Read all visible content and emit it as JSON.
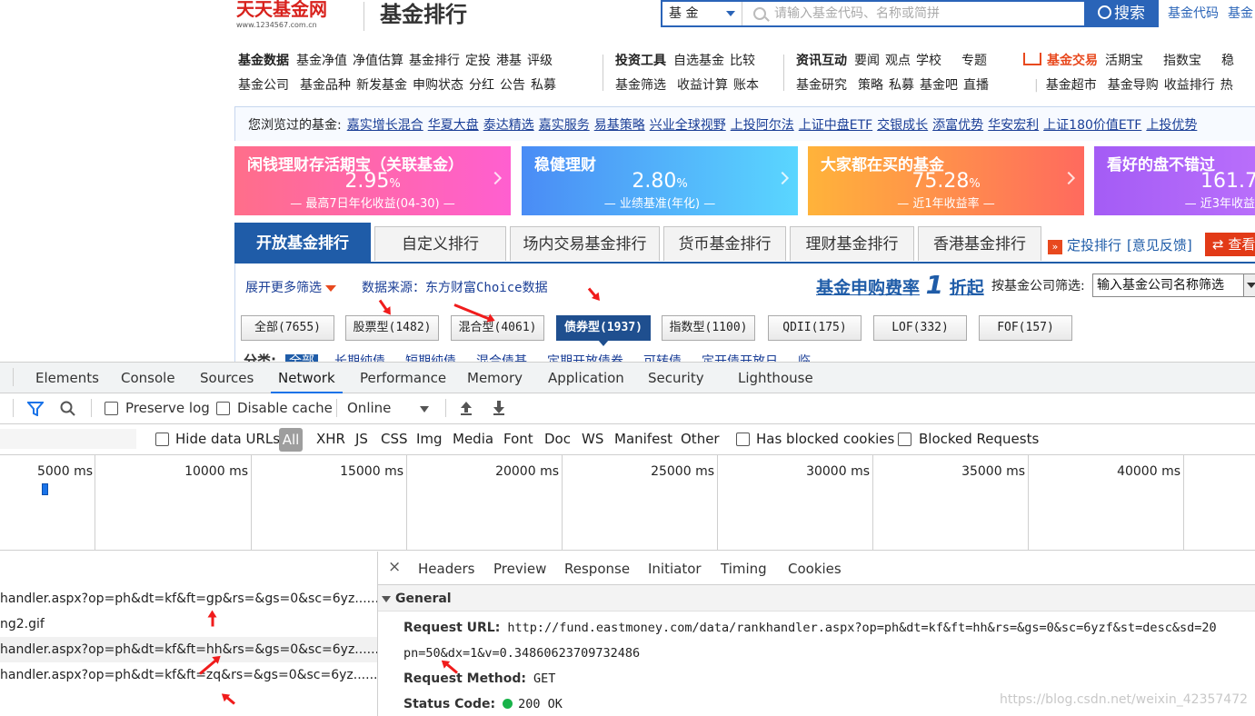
{
  "site": {
    "logo_text": "天天基金网",
    "logo_url": "www.1234567.com.cn",
    "page_title": "基金排行",
    "search": {
      "type_value": "基 金",
      "placeholder": "请输入基金代码、名称或简拼",
      "button": "搜索"
    },
    "top_links": [
      "基金代码",
      "基金"
    ],
    "nav_groups": [
      {
        "row1": {
          "title": "基金数据",
          "items": [
            "基金净值",
            "净值估算",
            "基金排行",
            "定投",
            "港基",
            "评级"
          ]
        },
        "row2": [
          "基金公司",
          "基金品种",
          "新发基金",
          "申购状态",
          "分红",
          "公告",
          "私募"
        ]
      },
      {
        "row1": {
          "title": "投资工具",
          "items": [
            "自选基金",
            "比较"
          ]
        },
        "row2": [
          "基金筛选",
          "收益计算",
          "账本"
        ]
      },
      {
        "row1": {
          "title": "资讯互动",
          "items": [
            "要闻",
            "观点",
            "学校",
            "专题"
          ]
        },
        "row2": [
          "基金研究",
          "策略",
          "私募",
          "基金吧",
          "直播"
        ]
      },
      {
        "row1": {
          "title": "基金交易",
          "items": [
            "活期宝",
            "指数宝",
            "稳"
          ]
        },
        "row2": [
          "基金超市",
          "基金导购",
          "收益排行",
          "热"
        ]
      }
    ],
    "browsed": {
      "label": "您浏览过的基金:",
      "items": [
        "嘉实增长混合",
        "华夏大盘",
        "泰达精选",
        "嘉实服务",
        "易基策略",
        "兴业全球视野",
        "上投阿尔法",
        "上证中盘ETF",
        "交银成长",
        "添富优势",
        "华安宏利",
        "上证180价值ETF",
        "上投优势"
      ]
    },
    "banners": [
      {
        "title": "闲钱理财存活期宝（关联基金）",
        "value": "2.95",
        "unit": "%",
        "sub": "— 最高7日年化收益(04-30) —",
        "color1": "#ff6e8a",
        "color2": "#ff5fd0"
      },
      {
        "title": "稳健理财",
        "value": "2.80",
        "unit": "%",
        "sub": "— 业绩基准(年化) —",
        "color1": "#4a8cf5",
        "color2": "#5ad6ff"
      },
      {
        "title": "大家都在买的基金",
        "value": "75.28",
        "unit": "%",
        "sub": "— 近1年收益率 —",
        "color1": "#ffb33a",
        "color2": "#ff6a5e"
      },
      {
        "title": "看好的盘不错过",
        "value": "161.7",
        "unit": "",
        "sub": "— 近3年收益",
        "color1": "#a45cf5",
        "color2": "#c77bff"
      }
    ],
    "tabs": [
      "开放基金排行",
      "自定义排行",
      "场内交易基金排行",
      "货币基金排行",
      "理财基金排行",
      "香港基金排行"
    ],
    "tab_links": {
      "dingtou": "定投排行",
      "feedback": "[意见反馈]",
      "view": "查看"
    },
    "filters": {
      "more": "展开更多筛选",
      "source": "数据来源：东方财富Choice数据",
      "fee_promo_a": "基金申购费率",
      "fee_promo_num": "1",
      "fee_promo_b": "折起",
      "company_label": "按基金公司筛选:",
      "company_placeholder": "输入基金公司名称筛选"
    },
    "fund_types": [
      {
        "label": "全部(7655)",
        "selected": false
      },
      {
        "label": "股票型(1482)",
        "selected": false
      },
      {
        "label": "混合型(4061)",
        "selected": false
      },
      {
        "label": "债券型(1937)",
        "selected": true
      },
      {
        "label": "指数型(1100)",
        "selected": false
      },
      {
        "label": "QDII(175)",
        "selected": false
      },
      {
        "label": "LOF(332)",
        "selected": false
      },
      {
        "label": "FOF(157)",
        "selected": false
      }
    ],
    "category_row": {
      "label": "分类:",
      "all": "全部",
      "items": [
        "长期纯债",
        "短期纯债",
        "混合债基",
        "定期开放债券",
        "可转债",
        "定开债开放日",
        "临"
      ]
    }
  },
  "devtools": {
    "panel_tabs": [
      "Elements",
      "Console",
      "Sources",
      "Network",
      "Performance",
      "Memory",
      "Application",
      "Security",
      "Lighthouse"
    ],
    "active_tab": "Network",
    "toolbar": {
      "preserve_log": "Preserve log",
      "disable_cache": "Disable cache",
      "throttle": "Online"
    },
    "filter_bar": {
      "hide_data_urls": "Hide data URLs",
      "types": [
        "All",
        "XHR",
        "JS",
        "CSS",
        "Img",
        "Media",
        "Font",
        "Doc",
        "WS",
        "Manifest",
        "Other"
      ],
      "has_blocked_cookies": "Has blocked cookies",
      "blocked_requests": "Blocked Requests"
    },
    "timeline_labels": [
      "5000 ms",
      "10000 ms",
      "15000 ms",
      "20000 ms",
      "25000 ms",
      "30000 ms",
      "35000 ms",
      "40000 ms"
    ],
    "requests": [
      "handler.aspx?op=ph&dt=kf&ft=gp&rs=&gs=0&sc=6yz......",
      "ng2.gif",
      "handler.aspx?op=ph&dt=kf&ft=hh&rs=&gs=0&sc=6yz......",
      "handler.aspx?op=ph&dt=kf&ft=zq&rs=&gs=0&sc=6yz......"
    ],
    "detail_tabs": [
      "Headers",
      "Preview",
      "Response",
      "Initiator",
      "Timing",
      "Cookies"
    ],
    "general": {
      "title": "General",
      "request_url_label": "Request URL:",
      "request_url": "http://fund.eastmoney.com/data/rankhandler.aspx?op=ph&dt=kf&ft=hh&rs=&gs=0&sc=6yzf&st=desc&sd=20",
      "request_url_cont": "pn=50&dx=1&v=0.34860623709732486",
      "method_label": "Request Method:",
      "method": "GET",
      "status_label": "Status Code:",
      "status": "200 OK"
    }
  },
  "watermark": "https://blog.csdn.net/weixin_42357472",
  "colors": {
    "brand_red": "#d8221d",
    "brand_blue": "#1f5ca8",
    "devtools_accent": "#1a73e8",
    "annotation_red": "#f01c1c"
  }
}
